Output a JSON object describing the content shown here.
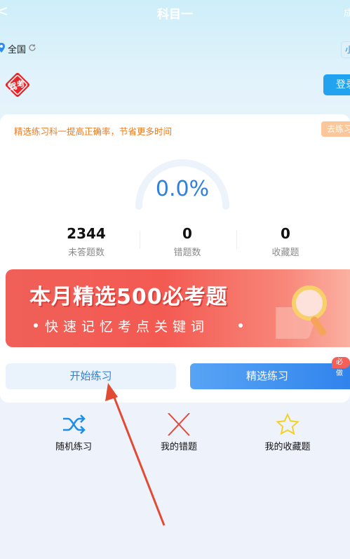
{
  "header": {
    "back_glyph": "<",
    "title": "科目一",
    "right_label": "成"
  },
  "location": {
    "region": "全国",
    "tag": "小"
  },
  "login_label": "登录",
  "card": {
    "tip": "精选练习科一提高正确率，节省更多时间",
    "go_button": "去练习",
    "percent": "0.0%",
    "stats": [
      {
        "value": "2344",
        "label": "未答题数"
      },
      {
        "value": "0",
        "label": "错题数"
      },
      {
        "value": "0",
        "label": "收藏题"
      }
    ]
  },
  "banner": {
    "title": "本月精选500必考题",
    "subtitle": "快速记忆考点关键词"
  },
  "buttons": {
    "start": "开始练习",
    "select": "精选练习",
    "badge": "必做"
  },
  "quick": [
    {
      "label": "随机练习",
      "icon": "shuffle-icon"
    },
    {
      "label": "我的错题",
      "icon": "close-x-icon"
    },
    {
      "label": "我的收藏题",
      "icon": "star-icon"
    }
  ],
  "logo_text": "驾考",
  "colors": {
    "accent_blue": "#2f7fe0",
    "orange": "#ef7a1f",
    "banner_red": "#f35a52",
    "annotation_arrow": "#e34a33"
  }
}
